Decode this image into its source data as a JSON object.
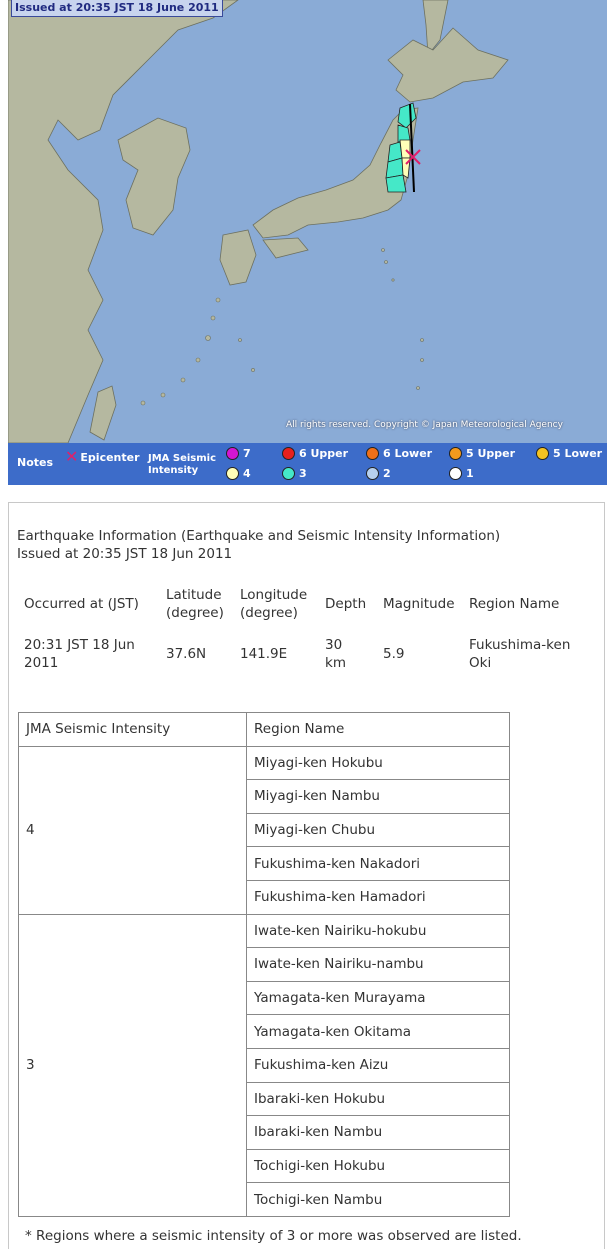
{
  "map": {
    "issued_label": "Issued at 20:35 JST  18 June 2011",
    "copyright": "All rights reserved. Copyright © Japan Meteorological Agency",
    "colors": {
      "sea": "#8aabd6",
      "land": "#b5b8a0",
      "int4": "#ffffb8",
      "int3": "#45e8c8",
      "epicenter": "#e0206a"
    }
  },
  "legend": {
    "notes_label": "Notes",
    "epicenter_label": "Epicenter",
    "jma_label_line1": "JMA Seismic",
    "jma_label_line2": "Intensity",
    "items": [
      {
        "label": "7",
        "color": "#d316d3"
      },
      {
        "label": "6 Upper",
        "color": "#e8201c"
      },
      {
        "label": "6 Lower",
        "color": "#f07018"
      },
      {
        "label": "5 Upper",
        "color": "#f39a1e"
      },
      {
        "label": "5 Lower",
        "color": "#f5c321"
      },
      {
        "label": "4",
        "color": "#ffffb8"
      },
      {
        "label": "3",
        "color": "#45e8c8"
      },
      {
        "label": "2",
        "color": "#b6d0ee"
      },
      {
        "label": "1",
        "color": "#ffffff"
      }
    ]
  },
  "info": {
    "title": "Earthquake Information (Earthquake and Seismic Intensity Information)",
    "issued": "Issued at 20:35 JST 18 Jun 2011"
  },
  "event": {
    "headers": {
      "occurred": "Occurred at (JST)",
      "lat1": "Latitude",
      "lat2": "(degree)",
      "lon1": "Longitude",
      "lon2": "(degree)",
      "depth": "Depth",
      "magnitude": "Magnitude",
      "region": "Region Name"
    },
    "values": {
      "occurred1": "20:31 JST 18 Jun",
      "occurred2": "2011",
      "lat": "37.6N",
      "lon": "141.9E",
      "depth1": "30",
      "depth2": "km",
      "magnitude": "5.9",
      "region1": "Fukushima-ken",
      "region2": "Oki"
    }
  },
  "intensity_table": {
    "header_intensity": "JMA Seismic Intensity",
    "header_region": "Region Name",
    "groups": [
      {
        "intensity": "4",
        "regions": [
          "Miyagi-ken Hokubu",
          "Miyagi-ken Nambu",
          "Miyagi-ken Chubu",
          "Fukushima-ken Nakadori",
          "Fukushima-ken Hamadori"
        ]
      },
      {
        "intensity": "3",
        "regions": [
          "Iwate-ken Nairiku-hokubu",
          "Iwate-ken Nairiku-nambu",
          "Yamagata-ken Murayama",
          "Yamagata-ken Okitama",
          "Fukushima-ken Aizu",
          "Ibaraki-ken Hokubu",
          "Ibaraki-ken Nambu",
          "Tochigi-ken Hokubu",
          "Tochigi-ken Nambu"
        ]
      }
    ]
  },
  "footnote": "* Regions where a seismic intensity of 3 or more was observed are listed."
}
